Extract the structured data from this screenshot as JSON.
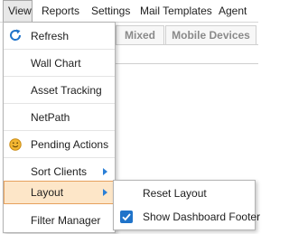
{
  "menubar": {
    "items": [
      {
        "label": "View"
      },
      {
        "label": "Reports"
      },
      {
        "label": "Settings"
      },
      {
        "label": "Mail Templates"
      },
      {
        "label": "Agent"
      }
    ]
  },
  "background_tabs": [
    {
      "label": "Mixed"
    },
    {
      "label": "Mobile Devices"
    }
  ],
  "view_menu": {
    "items": [
      {
        "label": "Refresh",
        "icon": "refresh-icon"
      },
      {
        "label": "Wall Chart"
      },
      {
        "label": "Asset Tracking"
      },
      {
        "label": "NetPath"
      },
      {
        "label": "Pending Actions",
        "icon": "smiley-icon"
      },
      {
        "label": "Sort Clients",
        "has_submenu": true
      },
      {
        "label": "Layout",
        "has_submenu": true,
        "highlighted": true
      },
      {
        "label": "Filter Manager"
      }
    ]
  },
  "layout_submenu": {
    "items": [
      {
        "label": "Reset Layout",
        "checked": false
      },
      {
        "label": "Show Dashboard Footer",
        "checked": true
      }
    ]
  },
  "colors": {
    "accent": "#1f73c9",
    "highlight_bg": "#fde6c8",
    "highlight_border": "#e6a15d"
  }
}
